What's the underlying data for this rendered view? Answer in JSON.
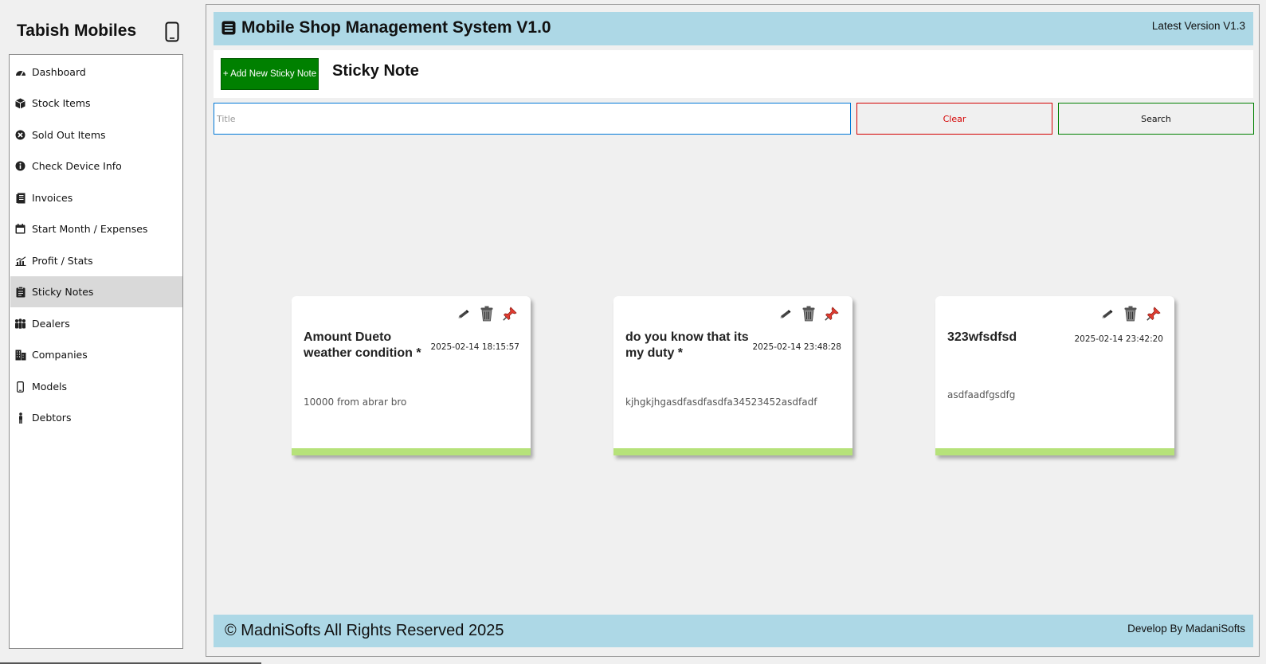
{
  "sidebar": {
    "brand": "Tabish Mobiles",
    "brand_icon": "phone-icon",
    "items": [
      {
        "label": "Dashboard",
        "icon": "dashboard-icon"
      },
      {
        "label": "Stock Items",
        "icon": "box-icon"
      },
      {
        "label": "Sold Out Items",
        "icon": "x-circle-icon"
      },
      {
        "label": "Check Device Info",
        "icon": "info-icon"
      },
      {
        "label": "Invoices",
        "icon": "invoice-icon"
      },
      {
        "label": "Start Month / Expenses",
        "icon": "calendar-icon"
      },
      {
        "label": "Profit / Stats",
        "icon": "chart-icon"
      },
      {
        "label": "Sticky Notes",
        "icon": "clipboard-icon",
        "active": true
      },
      {
        "label": "Dealers",
        "icon": "people-icon"
      },
      {
        "label": "Companies",
        "icon": "building-icon"
      },
      {
        "label": "Models",
        "icon": "phone-icon"
      },
      {
        "label": "Debtors",
        "icon": "person-icon"
      }
    ]
  },
  "header": {
    "title": "Mobile Shop Management System V1.0",
    "version": "Latest Version V1.3",
    "icon": "list-icon",
    "bg": "#add8e6"
  },
  "toolbar": {
    "add_button": "+ Add New Sticky Note",
    "page_title": "Sticky Note",
    "add_button_color": "#008000"
  },
  "search": {
    "placeholder": "Title",
    "value": "",
    "clear_label": "Clear",
    "search_label": "Search"
  },
  "notes": [
    {
      "title": "Amount Dueto weather condition *",
      "date": "2025-02-14 18:15:57",
      "body": "10000 from abrar bro"
    },
    {
      "title": "do you know that its my duty *",
      "date": "2025-02-14 23:48:28",
      "body": "kjhgkjhgasdfasdfasdfa34523452asdfadf"
    },
    {
      "title": "323wfsdfsd",
      "date": "2025-02-14 23:42:20",
      "body": "asdfaadfgsdfg"
    }
  ],
  "note_strip_color": "#b6e27a",
  "note_actions": [
    "edit-icon",
    "trash-icon",
    "pin-icon"
  ],
  "footer": {
    "copyright": "© MadniSofts All Rights Reserved 2025",
    "developer": "Develop By MadaniSofts"
  }
}
